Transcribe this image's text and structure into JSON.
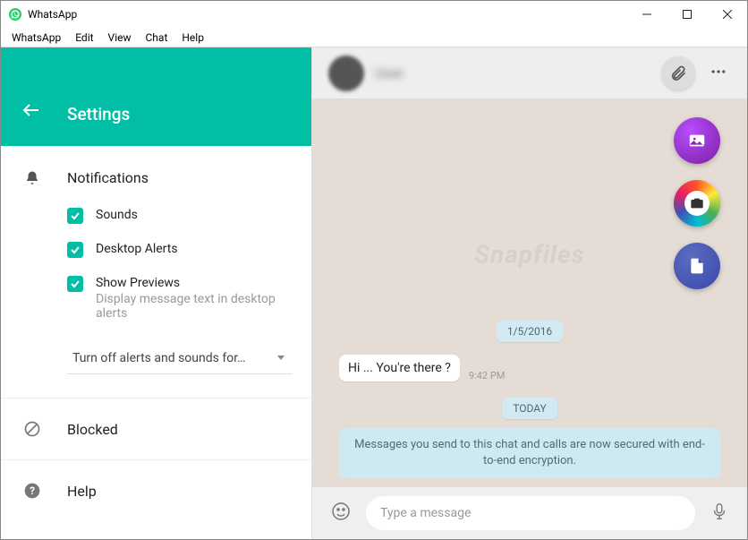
{
  "titlebar": {
    "title": "WhatsApp"
  },
  "menubar": [
    "WhatsApp",
    "Edit",
    "View",
    "Chat",
    "Help"
  ],
  "settings": {
    "title": "Settings",
    "notifications": {
      "title": "Notifications",
      "sounds": "Sounds",
      "desktop_alerts": "Desktop Alerts",
      "show_previews": "Show Previews",
      "show_previews_desc": "Display message text in desktop alerts",
      "turn_off": "Turn off alerts and sounds for…"
    },
    "blocked": "Blocked",
    "help": "Help"
  },
  "chat": {
    "contact_name": "User",
    "date1": "1/5/2016",
    "msg1": "Hi ... You're there ?",
    "msg1_time": "9:42 PM",
    "today": "TODAY",
    "encryption": "Messages you send to this chat and calls are now secured with end-to-end encryption.",
    "input_placeholder": "Type a message"
  },
  "watermark": "Snapfiles"
}
